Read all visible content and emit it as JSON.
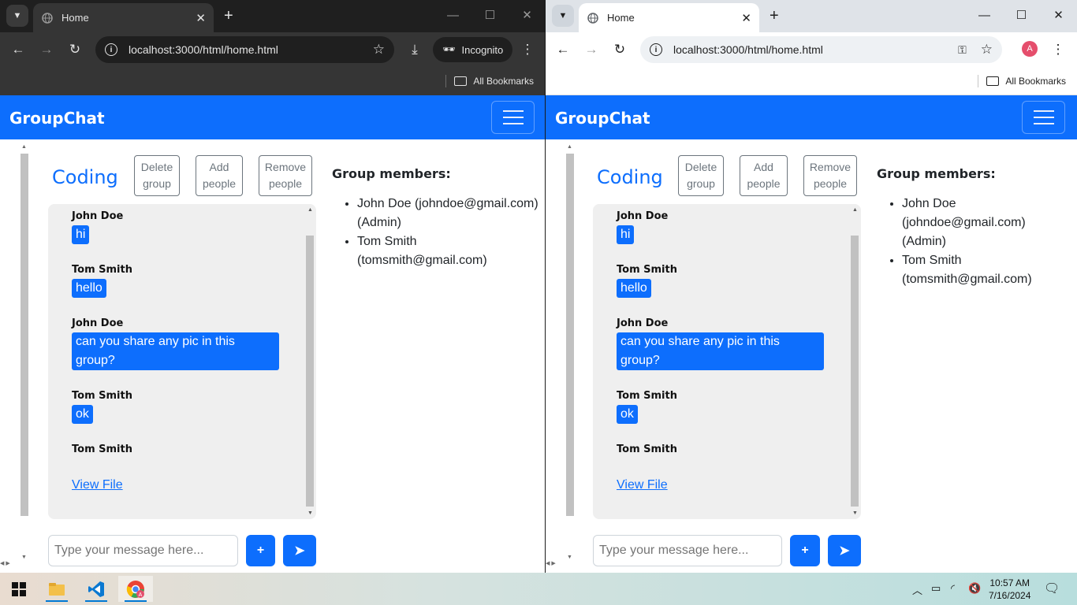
{
  "browser": {
    "tab_title": "Home",
    "url": "localhost:3000/html/home.html",
    "incognito_label": "Incognito",
    "bookmarks_label": "All Bookmarks",
    "profile_initial": "A"
  },
  "app": {
    "brand": "GroupChat",
    "group_name": "Coding",
    "buttons": {
      "delete_group": "Delete group",
      "add_people": "Add people",
      "remove_people": "Remove people",
      "attach": "+",
      "send": "➤"
    },
    "messages": [
      {
        "sender": "John Doe",
        "text": "hi"
      },
      {
        "sender": "Tom Smith",
        "text": "hello"
      },
      {
        "sender": "John Doe",
        "text": "can you share any pic in this group?"
      },
      {
        "sender": "Tom Smith",
        "text": "ok"
      },
      {
        "sender": "Tom Smith",
        "link": "View File"
      }
    ],
    "members_heading": "Group members:",
    "members": [
      "John Doe (johndoe@gmail.com) (Admin)",
      "Tom Smith (tomsmith@gmail.com)"
    ],
    "input_placeholder": "Type your message here..."
  },
  "taskbar": {
    "time": "10:57 AM",
    "date": "7/16/2024"
  },
  "colors": {
    "primary": "#0d6efd",
    "dark_chrome": "#353535",
    "light_chrome": "#dfe3e8"
  }
}
